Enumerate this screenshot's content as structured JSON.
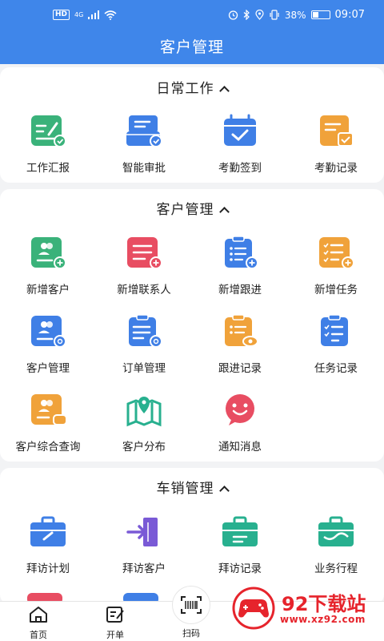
{
  "status_bar": {
    "network_badge": "HD",
    "signal_label": "4G",
    "battery_text": "38%",
    "battery_level": 0.38,
    "time": "09:07"
  },
  "header": {
    "title": "客户管理"
  },
  "sections": {
    "daily": {
      "title": "日常工作",
      "items": [
        "工作汇报",
        "智能审批",
        "考勤签到",
        "考勤记录"
      ]
    },
    "customer": {
      "title": "客户管理",
      "items": [
        "新增客户",
        "新增联系人",
        "新增跟进",
        "新增任务",
        "客户管理",
        "订单管理",
        "跟进记录",
        "任务记录",
        "客户综合查询",
        "客户分布",
        "通知消息"
      ]
    },
    "sales": {
      "title": "车销管理",
      "items": [
        "拜访计划",
        "拜访客户",
        "拜访记录",
        "业务行程"
      ]
    }
  },
  "bottom_nav": {
    "home": "首页",
    "order": "开单",
    "scan": "扫码"
  },
  "watermark": {
    "title": "92下载站",
    "url": "www.xz92.com"
  },
  "colors": {
    "primary": "#3f86ea",
    "green": "#3ab27a",
    "blue": "#3f7fe6",
    "orange": "#f0a23a",
    "red": "#e84d62",
    "purple": "#7a5ad6",
    "teal": "#28b08f",
    "watermark_red": "#e6242c"
  }
}
